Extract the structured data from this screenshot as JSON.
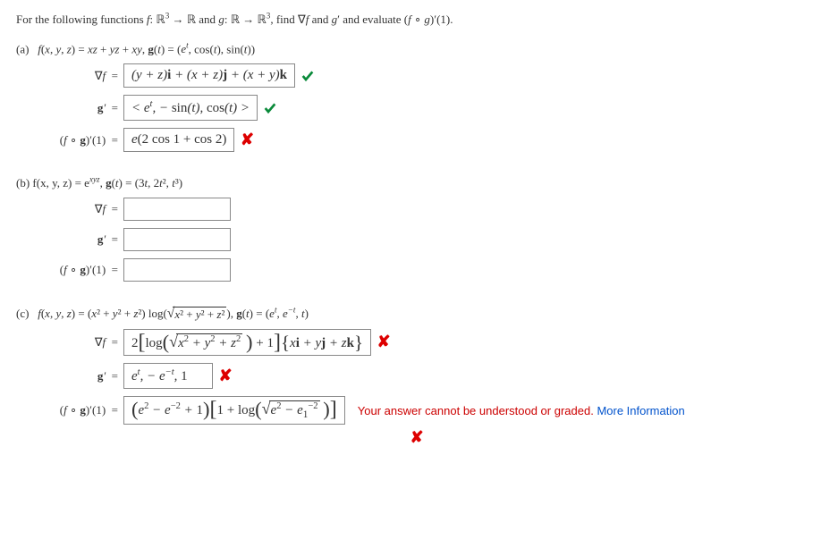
{
  "instructions": "For the following functions f: ℝ³ → ℝ and g: ℝ → ℝ³, find ∇f and g′ and evaluate (f ∘ g)′(1).",
  "parts": {
    "a": {
      "def": "(a)   f(x, y, z) = xz + yz + xy, g(t) = (eᵗ, cos(t), sin(t))",
      "grad_label": "∇f  =",
      "grad_ans": "(y + z)i + (x + z)j + (x + y)k",
      "grad_mark": "check",
      "gprime_label": "g′  =",
      "gprime_ans": "< eᵗ, − sin(t), cos(t) >",
      "gprime_mark": "check",
      "comp_label": "(f ∘ g)′(1)  =",
      "comp_ans": "e(2 cos 1 + cos 2)",
      "comp_mark": "cross"
    },
    "b": {
      "def_prefix": "(b)   f(x, y, z) = e",
      "def_exp": "xyz",
      "def_suffix": ", g(t) = (3t, 2t², t³)",
      "grad_label": "∇f  =",
      "grad_ans": "",
      "gprime_label": "g′  =",
      "gprime_ans": "",
      "comp_label": "(f ∘ g)′(1)  =",
      "comp_ans": ""
    },
    "c": {
      "def_plain": "(c)   f(x, y, z) = (x² + y² + z²) log(√(x² + y² + z²)), g(t) = (eᵗ, e⁻ᵗ, t)",
      "grad_label": "∇f  =",
      "grad_two": "2",
      "grad_log": "log",
      "grad_sqrt_body": "x² + y² + z²",
      "grad_plus1": " + 1",
      "grad_braces": "xi + yj + zk",
      "grad_mark": "cross",
      "gprime_label": "g′  =",
      "gprime_ans": "eᵗ, − e⁻ᵗ, 1",
      "gprime_mark": "cross",
      "comp_label": "(f ∘ g)′(1)  =",
      "comp_paren_inner_a": "e² − e",
      "comp_paren_exp": "−2",
      "comp_paren_inner_b": " + 1",
      "comp_br_text1": "1 + log",
      "comp_sqrt_a": "e² − e",
      "comp_sqrt_sub": "1",
      "comp_sqrt_exp": "−2",
      "comp_mark": "cross",
      "comp_feedback": "Your answer cannot be understood or graded. ",
      "comp_feedback_link": "More Information"
    }
  }
}
